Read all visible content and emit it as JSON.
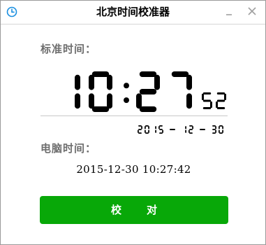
{
  "window": {
    "title": "北京时间校准器",
    "minimize_symbol": "_",
    "close_symbol": "✕",
    "accent_color": "#1a8fe0"
  },
  "standard_time": {
    "label": "标准时间：",
    "hours": "10",
    "minutes": "27",
    "seconds": "52",
    "date": "2015 - 12 - 30"
  },
  "computer_time": {
    "label": "电脑时间：",
    "value": "2015-12-30 10:27:42"
  },
  "actions": {
    "calibrate_label": "校对",
    "calibrate_color": "#08a808"
  },
  "icons": {
    "app": "clock-icon",
    "minimize": "minimize-icon",
    "close": "close-icon"
  }
}
